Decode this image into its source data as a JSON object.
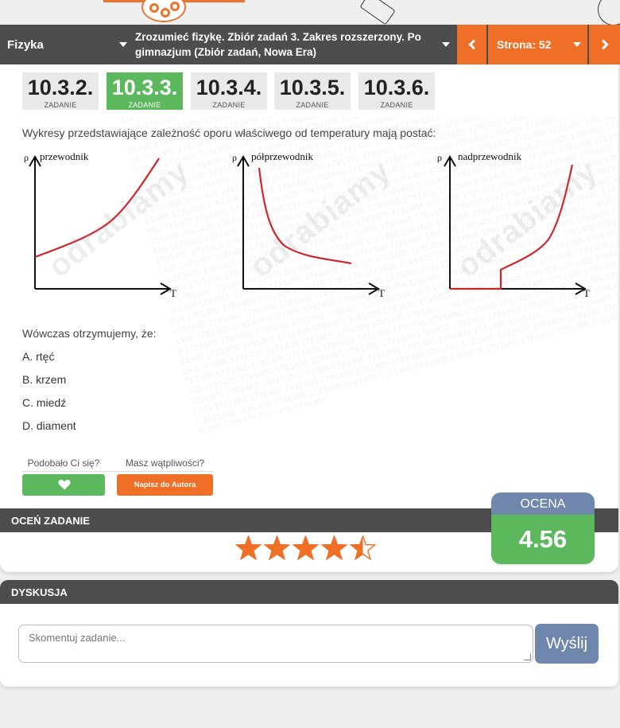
{
  "nav": {
    "subject": "Fizyka",
    "book": "Zrozumieć fizykę. Zbiór zadań 3. Zakres rozszerzony. Po gimnazjum (Zbiór zadań, Nowa Era)",
    "page_label": "Strona: 52"
  },
  "tasks": [
    {
      "number": "10.3.2.",
      "label": "ZADANIE",
      "active": false
    },
    {
      "number": "10.3.3.",
      "label": "ZADANIE",
      "active": true
    },
    {
      "number": "10.3.4.",
      "label": "ZADANIE",
      "active": false
    },
    {
      "number": "10.3.5.",
      "label": "ZADANIE",
      "active": false
    },
    {
      "number": "10.3.6.",
      "label": "ZADANIE",
      "active": false
    }
  ],
  "question": "Wykresy przedstawiające zależność oporu właściwego od temperatury mają postać:",
  "graphs": [
    {
      "title": "przewodnik",
      "y_label": "ρ",
      "x_label": "T",
      "curve": "rising"
    },
    {
      "title": "półprzewodnik",
      "y_label": "ρ",
      "x_label": "T",
      "curve": "falling"
    },
    {
      "title": "nadprzewodnik",
      "y_label": "ρ",
      "x_label": "T",
      "curve": "step-rising"
    }
  ],
  "watermark": {
    "logo": "odrabiamy",
    "code": "1781405"
  },
  "conclusion": "Wówczas otrzymujemy, że:",
  "answers": [
    "A. rtęć",
    "B. krzem",
    "C. miedź",
    "D. diament"
  ],
  "feedback": {
    "like_question": "Podobało Ci się?",
    "doubt_question": "Masz wątpliwości?",
    "write_button": "Napisz do Autora"
  },
  "rating": {
    "section_title": "OCEŃ ZADANIE",
    "stars_filled": 4.5,
    "stars_total": 5,
    "score_label": "OCENA",
    "score_value": "4.56"
  },
  "discussion": {
    "title": "DYSKUSJA",
    "placeholder": "Skomentuj zadanie...",
    "send_button": "Wyślij"
  },
  "colors": {
    "orange": "#ee6f25",
    "green": "#5cb85c",
    "dark": "#4d4d4d",
    "steel_blue": "#6f86ad",
    "curve_red": "#d0242b"
  }
}
